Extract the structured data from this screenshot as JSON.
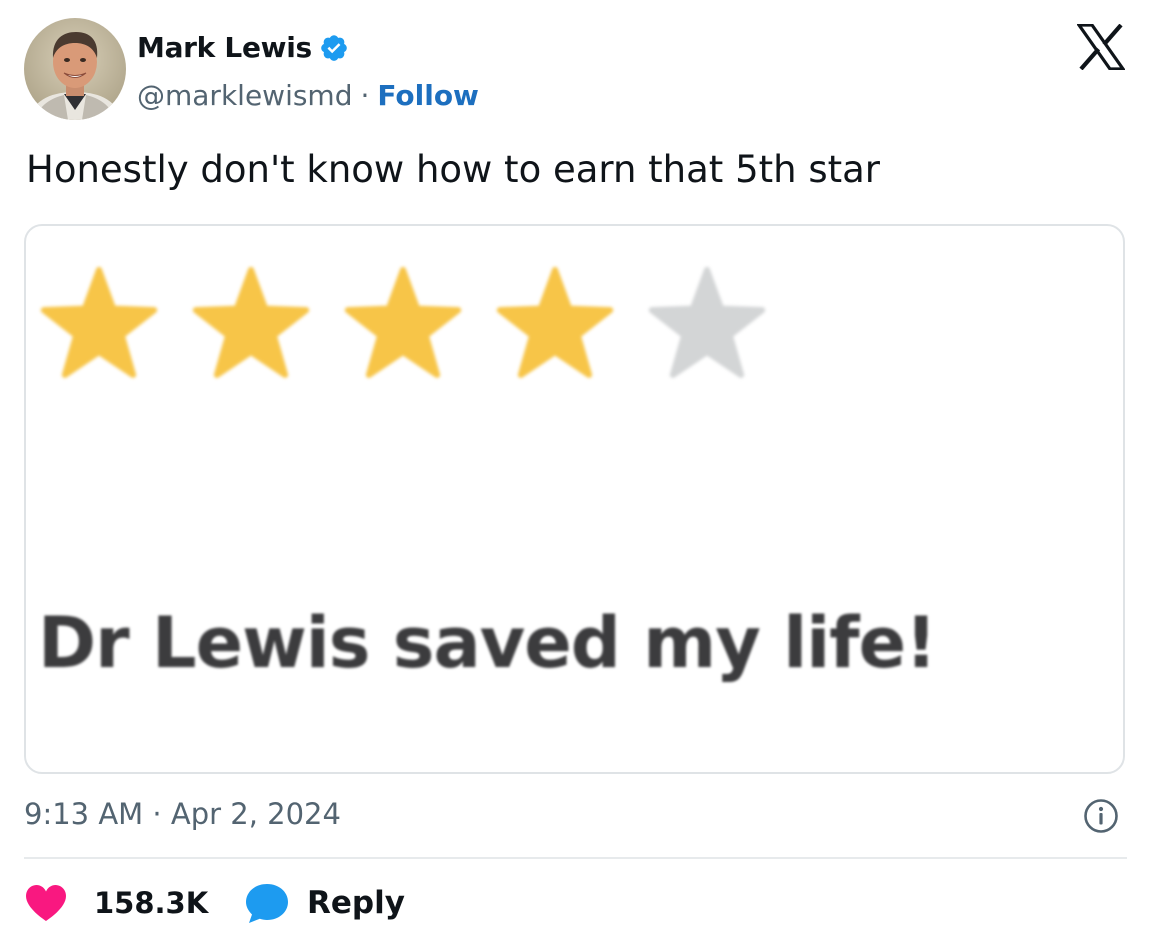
{
  "author": {
    "display_name": "Mark Lewis",
    "verified": true,
    "handle": "@marklewismd",
    "separator": "·",
    "follow_label": "Follow"
  },
  "platform_logo": "x-logo-icon",
  "tweet": {
    "text": "Honestly don't know how to earn that 5th star"
  },
  "media": {
    "rating": {
      "value": 4,
      "max": 5,
      "filled_color": "#f7c548",
      "empty_color": "#d3d5d6"
    },
    "review_text": "Dr Lewis saved my life!"
  },
  "timestamp": "9:13 AM · Apr 2, 2024",
  "actions": {
    "like_count": "158.3K",
    "reply_label": "Reply"
  },
  "colors": {
    "link_blue": "#1d6fbf",
    "verified_blue": "#1d9bf0",
    "heart_pink": "#f91880",
    "reply_blue": "#1d9bf0",
    "muted_text": "#536471"
  },
  "icons": [
    "verified-badge-icon",
    "x-logo-icon",
    "info-icon",
    "heart-icon",
    "reply-bubble-icon",
    "star-icon"
  ]
}
